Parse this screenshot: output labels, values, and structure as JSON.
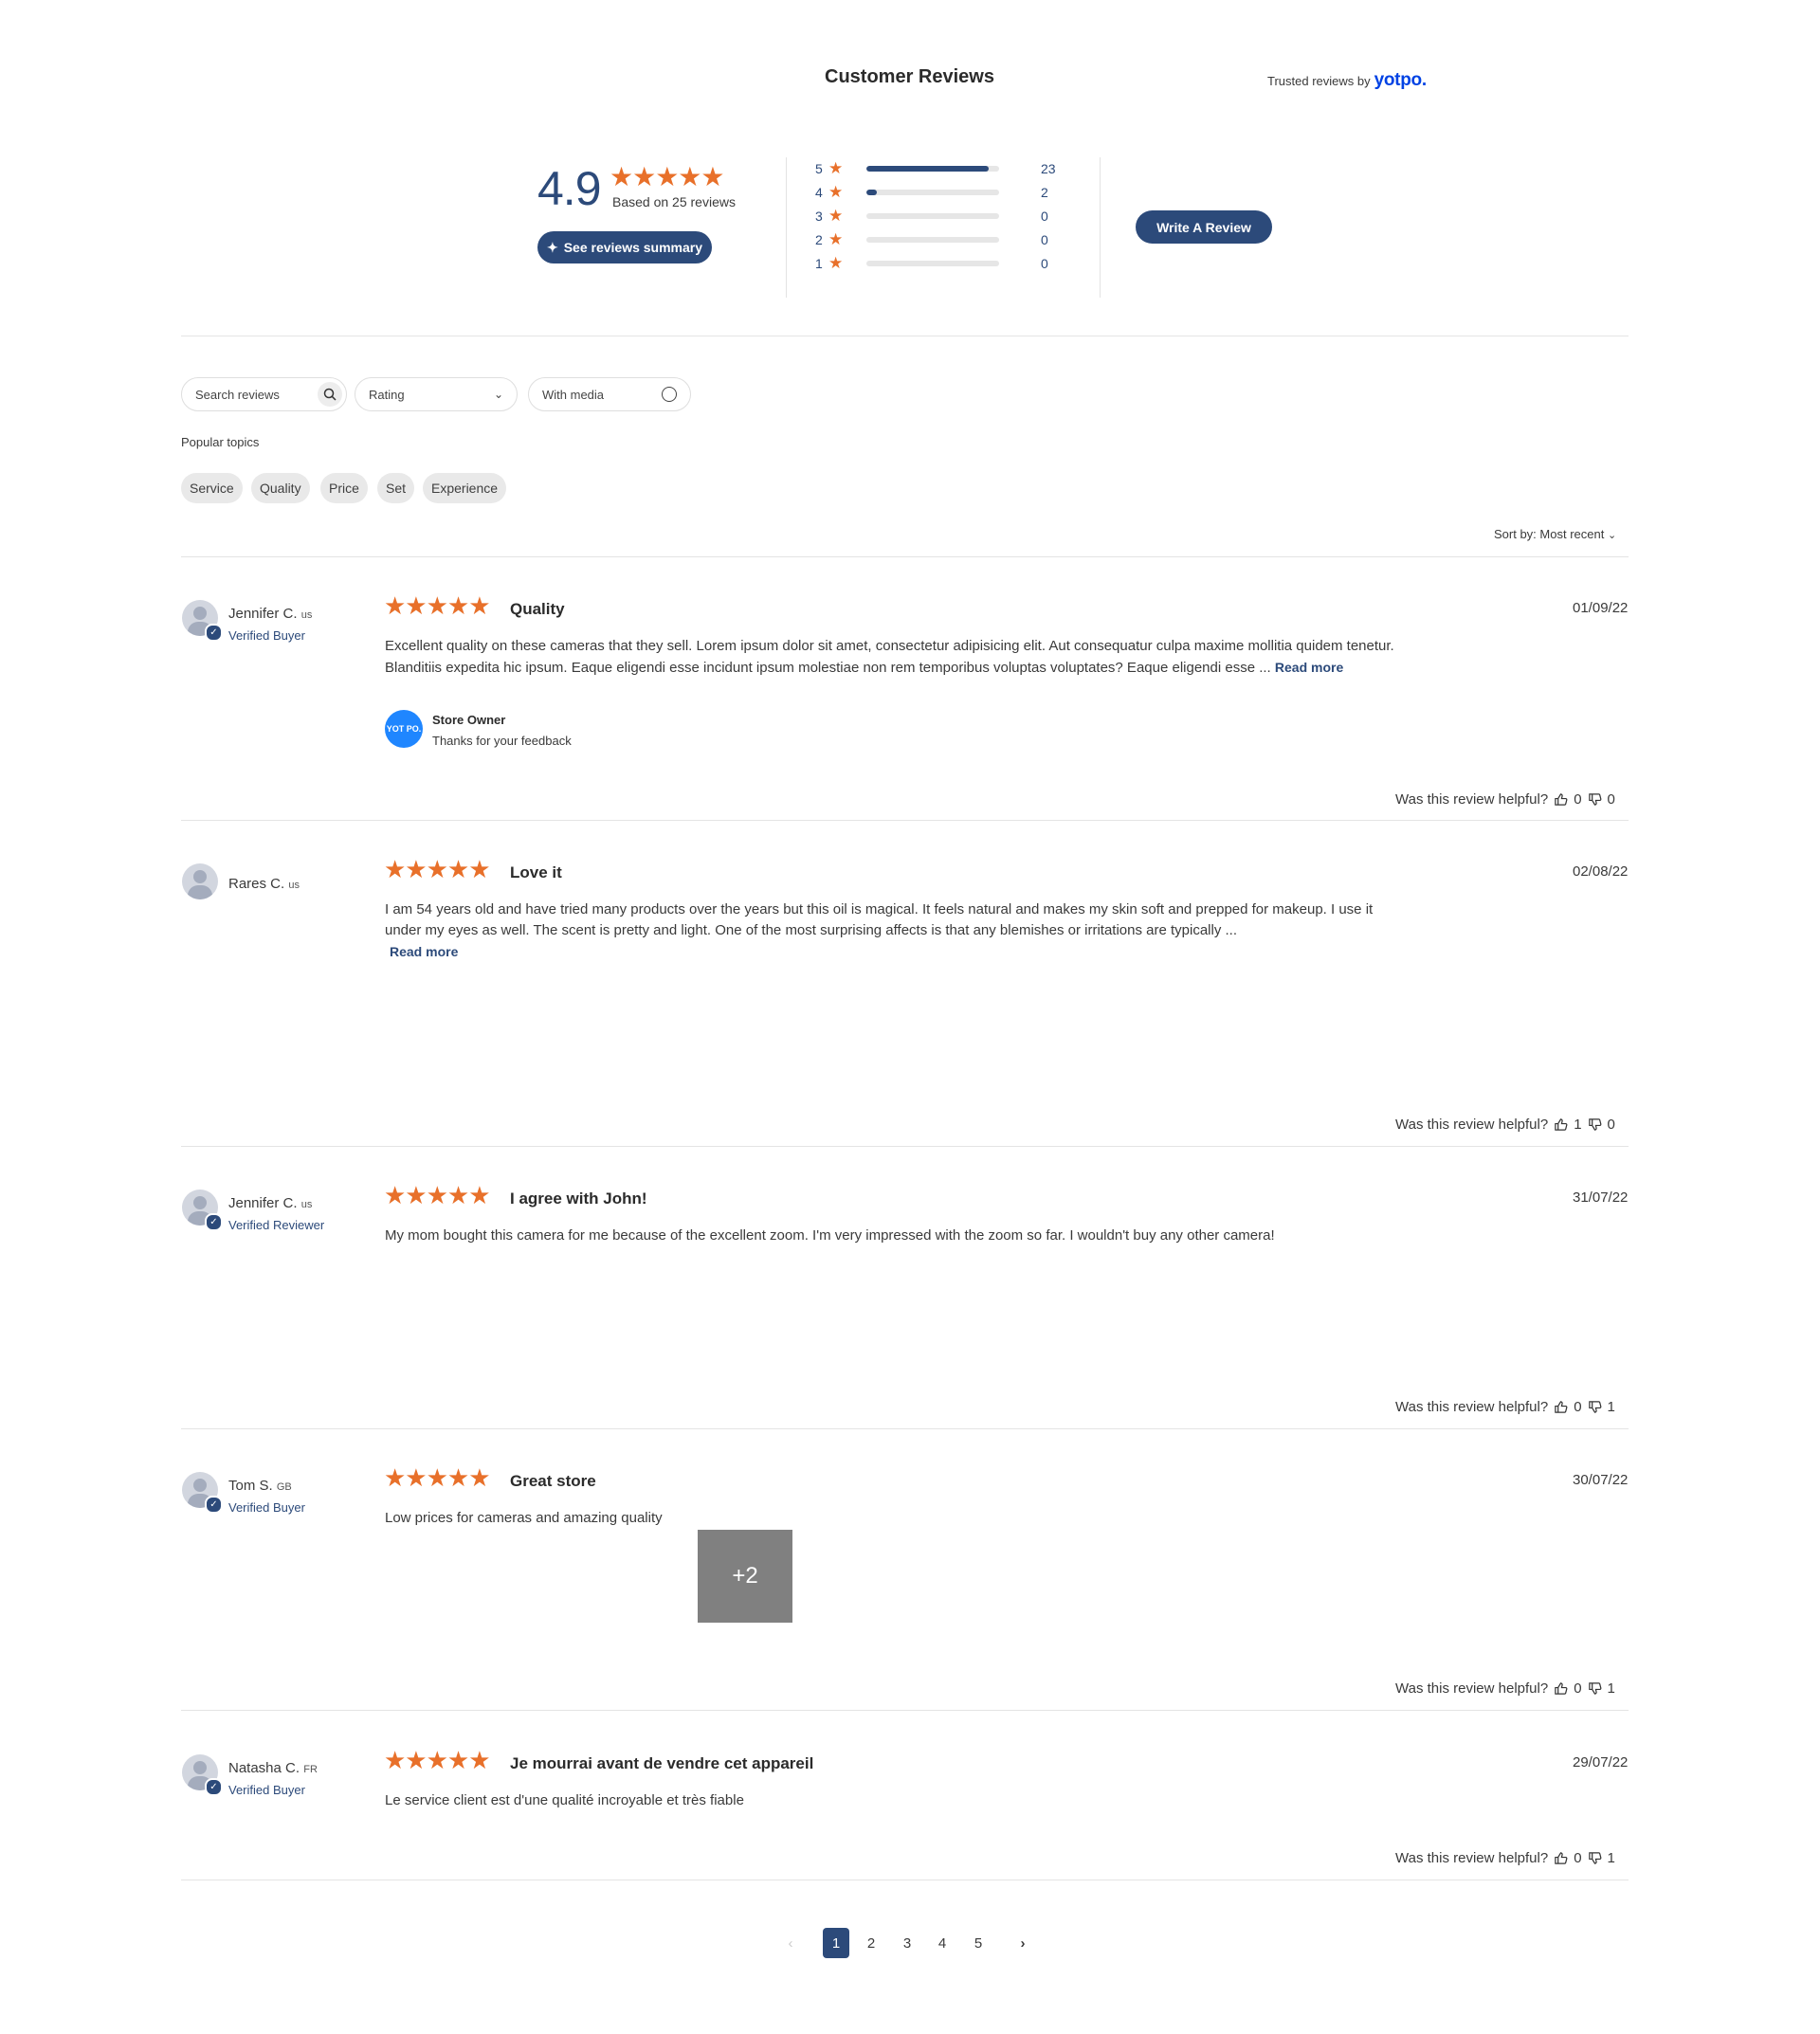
{
  "header": {
    "title": "Customer Reviews",
    "trusted_prefix": "Trusted reviews by",
    "trusted_brand": "yotpo."
  },
  "summary": {
    "average": "4.9",
    "stars": "★★★★★",
    "based_on": "Based on 25 reviews",
    "summary_button": "See reviews summary",
    "write_button": "Write A Review",
    "distribution": [
      {
        "stars": "5",
        "count": "23",
        "fraction": 0.92
      },
      {
        "stars": "4",
        "count": "2",
        "fraction": 0.08
      },
      {
        "stars": "3",
        "count": "0",
        "fraction": 0
      },
      {
        "stars": "2",
        "count": "0",
        "fraction": 0
      },
      {
        "stars": "1",
        "count": "0",
        "fraction": 0
      }
    ]
  },
  "filters": {
    "search_placeholder": "Search reviews",
    "rating_label": "Rating",
    "media_label": "With media",
    "popular_topics_label": "Popular topics",
    "topics": [
      "Service",
      "Quality",
      "Price",
      "Set",
      "Experience"
    ],
    "sort_label": "Sort by: Most recent"
  },
  "helpful_label": "Was this review helpful?",
  "reviews": [
    {
      "name": "Jennifer C.",
      "country": "us",
      "badge": "Verified Buyer",
      "stars": "★★★★★",
      "title": "Quality",
      "date": "01/09/22",
      "body": "Excellent quality on these cameras that they sell. Lorem ipsum dolor sit amet, consectetur adipisicing elit. Aut consequatur culpa maxime mollitia quidem tenetur. Blanditiis expedita hic ipsum. Eaque eligendi esse incidunt ipsum molestiae non rem temporibus voluptas voluptates? Eaque eligendi esse ...",
      "read_more": "Read more",
      "owner_logo": "YOT PO.",
      "owner_label": "Store Owner",
      "owner_reply": "Thanks for your feedback",
      "up": "0",
      "down": "0"
    },
    {
      "name": "Rares C.",
      "country": "us",
      "badge": "",
      "stars": "★★★★★",
      "title": "Love it",
      "date": "02/08/22",
      "body": "I am 54 years old and have tried many products over the years but this oil is magical. It feels natural and makes my skin soft and prepped for makeup. I use it under my eyes as well. The scent is pretty and light. One of the most surprising affects is that any blemishes or irritations are typically ...",
      "read_more": "Read more",
      "up": "1",
      "down": "0"
    },
    {
      "name": "Jennifer C.",
      "country": "us",
      "badge": "Verified Reviewer",
      "stars": "★★★★★",
      "title": "I agree with John!",
      "date": "31/07/22",
      "body": "My mom bought this camera for me because of the excellent zoom. I'm very impressed with the zoom so far. I wouldn't buy any other camera!",
      "up": "0",
      "down": "1"
    },
    {
      "name": "Tom S.",
      "country": "GB",
      "badge": "Verified Buyer",
      "stars": "★★★★★",
      "title": "Great store",
      "date": "30/07/22",
      "body": "Low prices for cameras and amazing quality",
      "media_more": "+2",
      "up": "0",
      "down": "1"
    },
    {
      "name": "Natasha C.",
      "country": "FR",
      "badge": "Verified Buyer",
      "stars": "★★★★★",
      "title": "Je mourrai avant de vendre cet appareil",
      "date": "29/07/22",
      "body": "Le service client est d'une qualité incroyable et très fiable",
      "up": "0",
      "down": "1"
    }
  ],
  "pagination": {
    "pages": [
      "1",
      "2",
      "3",
      "4",
      "5"
    ],
    "current": "1"
  }
}
